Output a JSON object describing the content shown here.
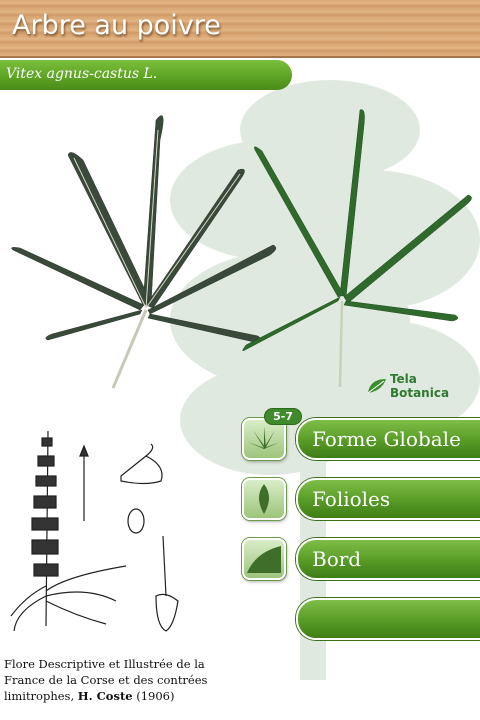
{
  "header": {
    "title": "Arbre au poivre"
  },
  "species": {
    "latin_name": "Vitex agnus-castus L."
  },
  "logo": {
    "text": "Tela Botanica"
  },
  "criteria": {
    "global_shape": {
      "label": "Forme Globale",
      "badge": "5-7",
      "icon": "palmate-leaf-icon"
    },
    "leaflets": {
      "label": "Folioles",
      "icon": "single-leaflet-icon"
    },
    "edge": {
      "label": "Bord",
      "icon": "leaf-edge-icon"
    },
    "empty": {
      "label": ""
    }
  },
  "credits": {
    "line": "Flore Descriptive et Illustrée de la France de la Corse et des contrées limitrophes,",
    "author": "H. Coste",
    "year": "(1906)"
  },
  "colors": {
    "accent_green": "#5ea524",
    "header_wood": "#d9a774"
  }
}
